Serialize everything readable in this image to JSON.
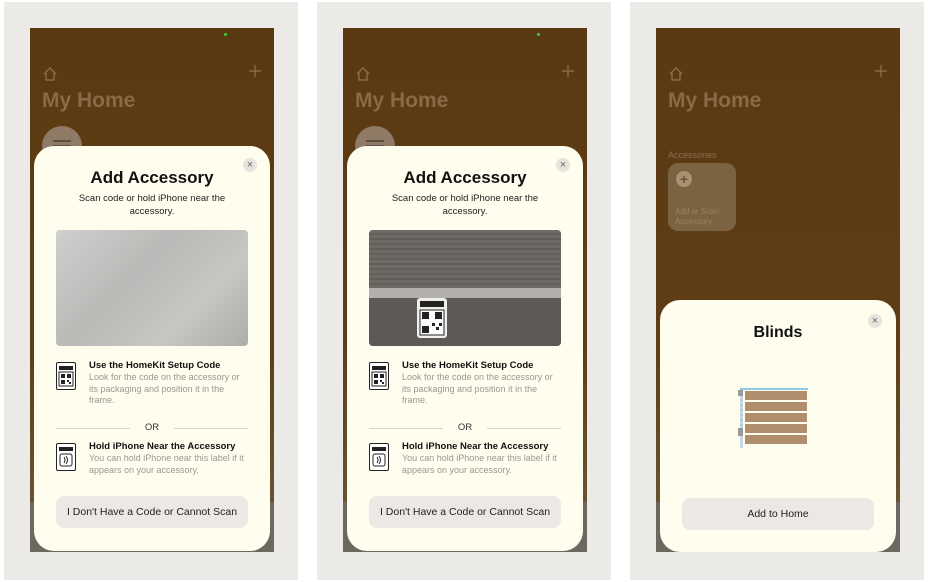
{
  "home": {
    "title": "My Home",
    "accessories_label": "Accessories",
    "add_tile_label": "Add or Scan Accessory"
  },
  "add_accessory": {
    "title": "Add Accessory",
    "subtitle": "Scan code or hold iPhone near the accessory.",
    "option_code_title": "Use the HomeKit Setup Code",
    "option_code_desc": "Look for the code on the accessory or its packaging and position it in the frame.",
    "or_label": "OR",
    "option_nfc_title": "Hold iPhone Near the Accessory",
    "option_nfc_desc": "You can hold iPhone near this label if it appears on your accessory.",
    "no_code_button": "I Don't Have a Code or Cannot Scan",
    "close_glyph": "×"
  },
  "blinds_sheet": {
    "title": "Blinds",
    "add_button": "Add to Home",
    "close_glyph": "×"
  },
  "colors": {
    "accent_bg": "#5a3a13",
    "sheet_bg": "#fffdee",
    "button_bg": "#ebe8e6"
  },
  "icons": [
    "home-icon",
    "plus-icon",
    "qr-code-icon",
    "nfc-icon",
    "close-icon",
    "blinds-icon"
  ]
}
